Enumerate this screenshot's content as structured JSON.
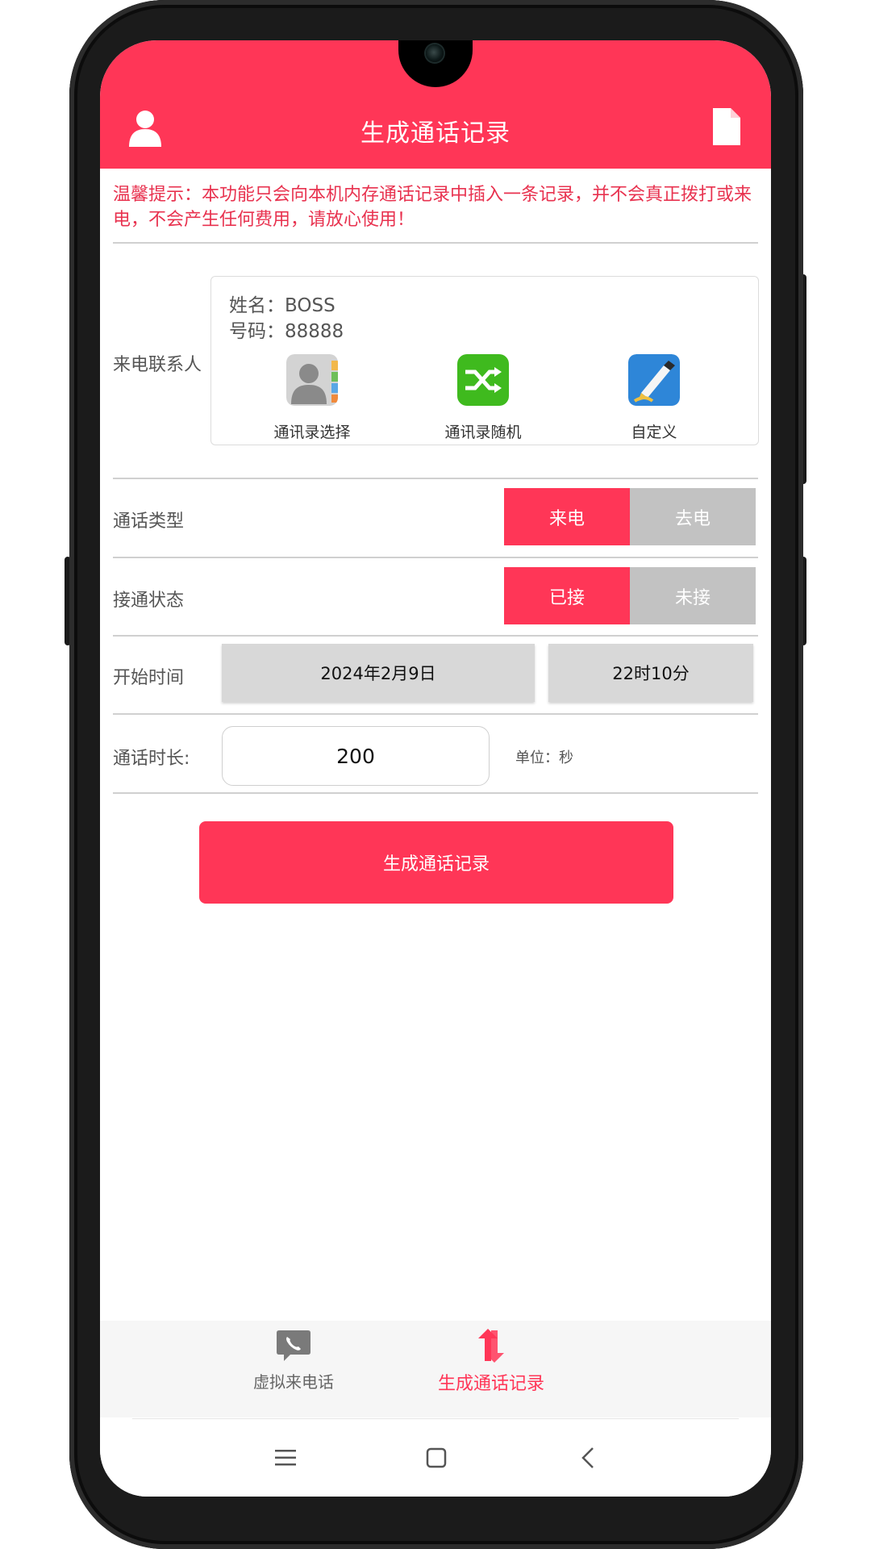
{
  "header": {
    "title": "生成通话记录",
    "user_icon": "user-icon",
    "doc_icon": "document-icon"
  },
  "notice": "温馨提示：本功能只会向本机内存通话记录中插入一条记录，并不会真正拨打或来电，不会产生任何费用，请放心使用！",
  "contact": {
    "label": "来电联系人",
    "name_line": "姓名：BOSS",
    "number_line": "号码：88888",
    "options": [
      {
        "label": "通讯录选择",
        "icon": "contacts-book-icon"
      },
      {
        "label": "通讯录随机",
        "icon": "shuffle-icon"
      },
      {
        "label": "自定义",
        "icon": "pen-icon"
      }
    ]
  },
  "call_type": {
    "label": "通话类型",
    "options": [
      "来电",
      "去电"
    ],
    "selected": "来电"
  },
  "connect_status": {
    "label": "接通状态",
    "options": [
      "已接",
      "未接"
    ],
    "selected": "已接"
  },
  "start_time": {
    "label": "开始时间",
    "date": "2024年2月9日",
    "time": "22时10分"
  },
  "duration": {
    "label": "通话时长:",
    "value": "200",
    "unit": "单位：秒"
  },
  "generate_button": "生成通话记录",
  "tabs": [
    {
      "label": "虚拟来电话",
      "icon": "phone-chat-icon",
      "active": false
    },
    {
      "label": "生成通话记录",
      "icon": "refresh-arrows-icon",
      "active": true
    }
  ],
  "colors": {
    "accent": "#ff3657",
    "inactive": "#c2c2c2",
    "notice_text": "#e8324f"
  }
}
